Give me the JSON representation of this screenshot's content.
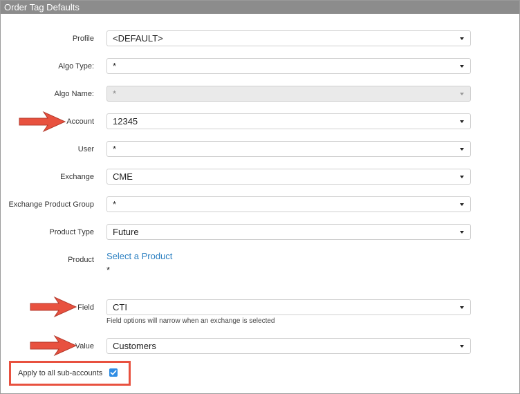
{
  "window": {
    "title": "Order Tag Defaults"
  },
  "form": {
    "profile": {
      "label": "Profile",
      "value": "<DEFAULT>"
    },
    "algo_type": {
      "label": "Algo Type:",
      "value": "*"
    },
    "algo_name": {
      "label": "Algo Name:",
      "value": "*",
      "disabled": true
    },
    "account": {
      "label": "Account",
      "value": "12345"
    },
    "user": {
      "label": "User",
      "value": "*"
    },
    "exchange": {
      "label": "Exchange",
      "value": "CME"
    },
    "exchange_product_group": {
      "label": "Exchange Product Group",
      "value": "*"
    },
    "product_type": {
      "label": "Product Type",
      "value": "Future"
    },
    "product": {
      "label": "Product",
      "link_text": "Select a Product",
      "value": "*"
    },
    "field": {
      "label": "Field",
      "value": "CTI",
      "hint": "Field options will narrow when an exchange is selected"
    },
    "value": {
      "label": "Value",
      "value": "Customers"
    },
    "apply_all": {
      "label": "Apply to all sub-accounts",
      "checked": true
    }
  },
  "colors": {
    "accent": "#2a7fc1",
    "annotation": "#e8513f",
    "title_bar": "#8c8c8c",
    "checkbox": "#2f8de4"
  },
  "icons": [
    "chevron-down-icon",
    "check-icon",
    "annotation-arrow-icon"
  ]
}
